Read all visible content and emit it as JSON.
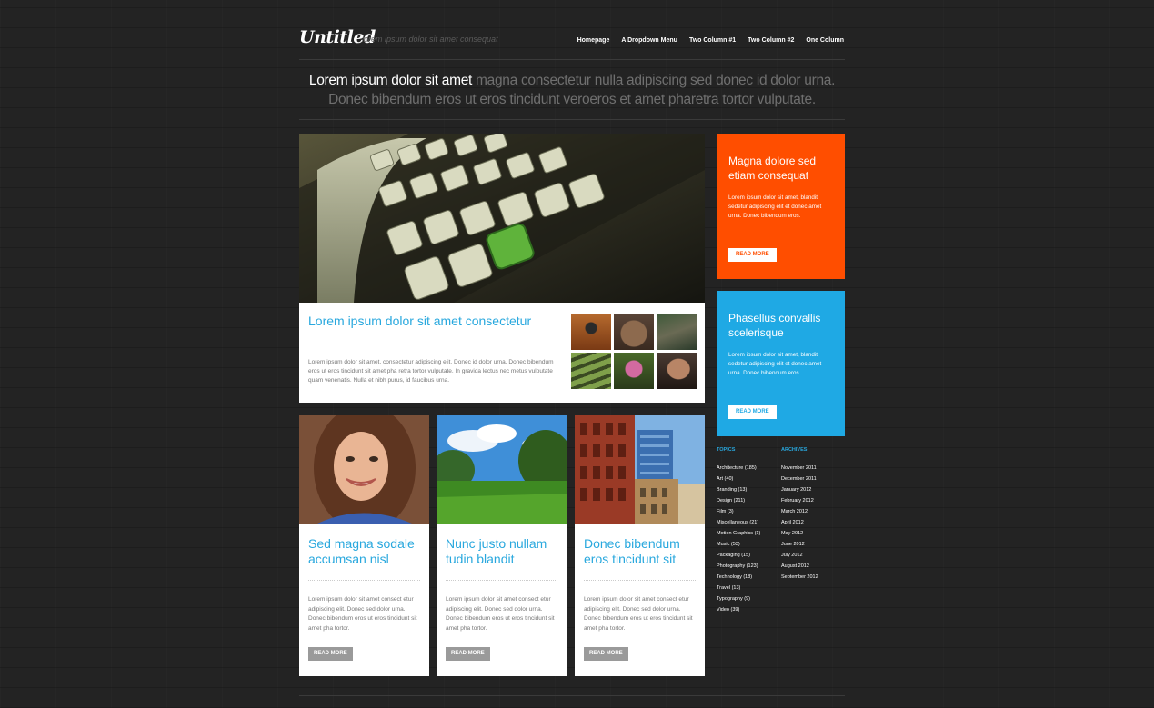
{
  "header": {
    "logo": "Untitled",
    "tagline": "lorem ipsum dolor sit amet consequat",
    "nav": [
      "Homepage",
      "A Dropdown Menu",
      "Two Column #1",
      "Two Column #2",
      "One Column"
    ]
  },
  "intro": {
    "highlight": "Lorem ipsum dolor sit amet",
    "rest": " magna consectetur nulla adipiscing sed donec id dolor urna. Donec bibendum eros ut eros tincidunt veroeros et amet pharetra tortor vulputate."
  },
  "featured": {
    "title": "Lorem ipsum dolor sit amet consectetur",
    "body": "Lorem ipsum dolor sit amet, consectetur adipiscing elit. Donec id dolor urna. Donec bibendum eros ut eros tincidunt sit amet pha retra tortor vulputate. In gravida lectus nec metus vulputate quam venenatis. Nulla et nibh purus, id faucibus urna."
  },
  "cards": [
    {
      "title": "Sed magna sodale accumsan nisl",
      "body": "Lorem ipsum dolor sit amet consect etur adipiscing elit. Donec sed dolor urna. Donec bibendum eros ut eros tincidunt sit amet pha tortor.",
      "button": "READ MORE"
    },
    {
      "title": "Nunc justo nullam tudin blandit",
      "body": "Lorem ipsum dolor sit amet consect etur adipiscing elit. Donec sed dolor urna. Donec bibendum eros ut eros tincidunt sit amet pha tortor.",
      "button": "READ MORE"
    },
    {
      "title": "Donec bibendum eros tincidunt sit",
      "body": "Lorem ipsum dolor sit amet consect etur adipiscing elit. Donec sed dolor urna. Donec bibendum eros ut eros tincidunt sit amet pha tortor.",
      "button": "READ MORE"
    }
  ],
  "promos": [
    {
      "title": "Magna dolore sed etiam consequat",
      "body": "Lorem ipsum dolor sit amet, blandit sedetur adipiscing elit et donec amet urna. Donec bibendum eros.",
      "button": "READ MORE",
      "color": "#ff4e00"
    },
    {
      "title": "Phasellus convallis scelerisque",
      "body": "Lorem ipsum dolor sit amet, blandit sedetur adipiscing elit et donec amet urna. Donec bibendum eros.",
      "button": "READ MORE",
      "color": "#1fa9e4"
    }
  ],
  "topics": {
    "heading": "TOPICS",
    "items": [
      "Architecture (185)",
      "Art (40)",
      "Branding (13)",
      "Design (211)",
      "Film (3)",
      "Miscellaneous (21)",
      "Motion Graphics (1)",
      "Music (53)",
      "Packaging (15)",
      "Photography (123)",
      "Technology (18)",
      "Travel (13)",
      "Typography (9)",
      "Video (39)"
    ]
  },
  "archives": {
    "heading": "ARCHIVES",
    "items": [
      "November 2011",
      "December 2011",
      "January 2012",
      "February 2012",
      "March 2012",
      "April 2012",
      "May 2012",
      "June 2012",
      "July 2012",
      "August 2012",
      "September 2012"
    ]
  },
  "colors": {
    "accent": "#29a8de",
    "orange": "#ff4e00",
    "blue": "#1fa9e4",
    "background": "#232323"
  }
}
